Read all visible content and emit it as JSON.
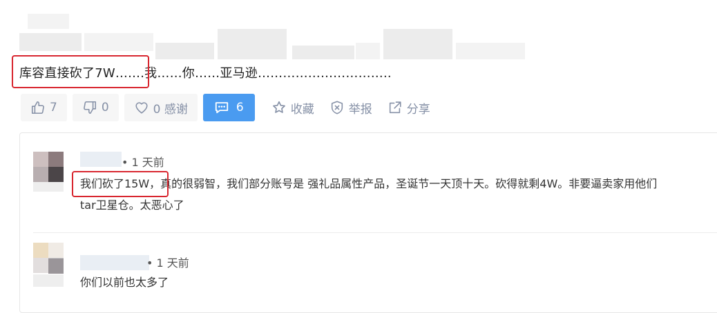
{
  "post": {
    "text": "库容直接砍了7W…….我……你……亚马逊………………………….."
  },
  "actions": {
    "like_count": "7",
    "dislike_count": "0",
    "thanks_label": "0 感谢",
    "comment_count": "6",
    "favorite_label": "收藏",
    "report_label": "举报",
    "share_label": "分享"
  },
  "comments": [
    {
      "time": "• 1 天前",
      "line1": "我们砍了15W，真的很弱智，我们部分账号是 强礼品属性产品，圣诞节一天顶十天。砍得就剩4W。非要逼卖家用他们",
      "line2": "tar卫星仓。太恶心了"
    },
    {
      "time": "• 1 天前",
      "line1": "你们以前也太多了"
    }
  ],
  "colors": {
    "highlight_box": "#d8262f",
    "comment_button": "#4a9bf0",
    "icon_gray": "#8590a6"
  }
}
